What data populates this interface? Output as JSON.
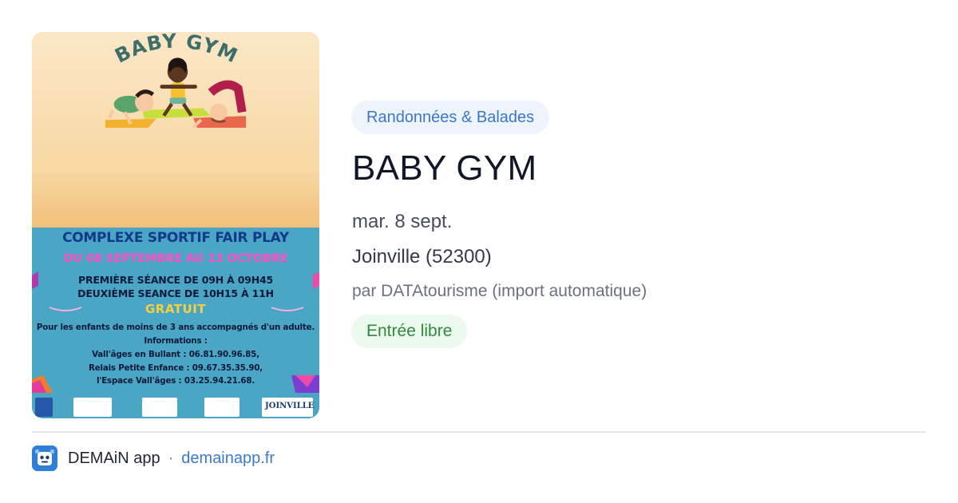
{
  "poster": {
    "title": "BABY GYM",
    "venue": "COMPLEXE SPORTIF FAIR PLAY",
    "dates": "DU 08 SEPTEMBRE AU 13 OCTOBRE",
    "session_1": "PREMIÈRE SÉANCE DE 09H À 09H45",
    "session_2": "DEUXIÈME SEANCE DE 10H15 À 11H",
    "free": "GRATUIT",
    "info_lines": [
      "Pour les enfants de moins de 3 ans accompagnés d'un adulte.",
      "Informations :",
      "Vall'âges en Bullant : 06.81.90.96.85,",
      "Relais Petite Enfance : 09.67.35.35.90,",
      "l'Espace Vall'âges : 03.25.94.21.68."
    ],
    "logo_text": "JOINVILLE"
  },
  "event": {
    "category": "Randonnées & Balades",
    "title": "BABY GYM",
    "date": "mar. 8 sept.",
    "location": "Joinville (52300)",
    "author": "par DATAtourisme (import automatique)",
    "price": "Entrée libre"
  },
  "footer": {
    "app_name": "DEMAiN app",
    "separator": "·",
    "site": "demainapp.fr"
  },
  "colors": {
    "category_text": "#3b76c9",
    "price_text": "#2f8a3b",
    "site_link": "#3a7ad0",
    "app_icon": "#2f7fd8"
  },
  "icons": {
    "app": "demain-app-icon"
  }
}
